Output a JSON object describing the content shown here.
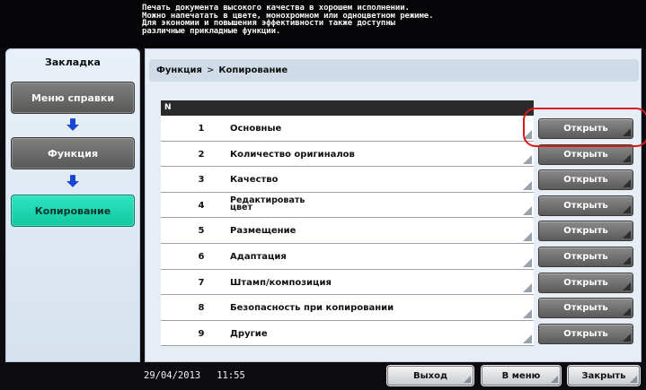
{
  "message": "Печать документа высокого качества в хорошем исполнении.\nМожно напечатать в цвете, монохромном или одноцветном режиме.\nДля экономии и повышения эффективности также доступны\nразличные прикладные функции.",
  "sidebar": {
    "title": "Закладка",
    "items": [
      {
        "label": "Меню справки",
        "state": "grey"
      },
      {
        "label": "Функция",
        "state": "grey"
      },
      {
        "label": "Копирование",
        "state": "active"
      }
    ]
  },
  "breadcrumb": {
    "part1": "Функция",
    "separator": ">",
    "part2": "Копирование"
  },
  "table": {
    "header": "N",
    "button_label": "Открыть",
    "rows": [
      {
        "num": "1",
        "label": "Основные"
      },
      {
        "num": "2",
        "label": "Количество оригиналов"
      },
      {
        "num": "3",
        "label": "Качество"
      },
      {
        "num": "4",
        "label": "Редактировать\nцвет"
      },
      {
        "num": "5",
        "label": "Размещение"
      },
      {
        "num": "6",
        "label": "Адаптация"
      },
      {
        "num": "7",
        "label": "Штамп/композиция"
      },
      {
        "num": "8",
        "label": "Безопасность при копировании"
      },
      {
        "num": "9",
        "label": "Другие"
      }
    ]
  },
  "status": {
    "date": "29/04/2013",
    "time": "11:55"
  },
  "buttons": {
    "exit": "Выход",
    "to_menu": "В меню",
    "close": "Закрыть"
  },
  "colors": {
    "active_tab": "#1fd6b0",
    "highlight": "#d81c1c",
    "arrow": "#1746d6"
  }
}
